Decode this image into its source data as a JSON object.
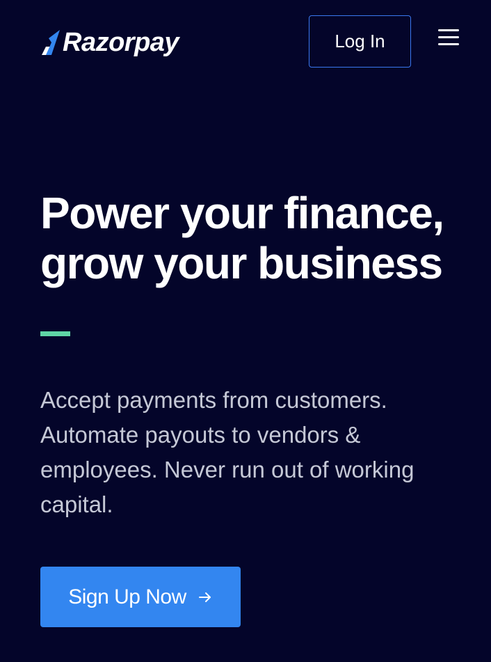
{
  "header": {
    "logo_text": "Razorpay",
    "login_label": "Log In",
    "menu_icon": "hamburger-menu-icon"
  },
  "hero": {
    "title_line1": "Power your finance,",
    "title_line2": "grow your business",
    "subtitle": "Accept payments from customers. Automate payouts to vendors & employees. Never run out of working capital.",
    "cta_label": "Sign Up Now",
    "cta_icon": "arrow-right-icon"
  },
  "colors": {
    "background": "#04052a",
    "accent_green": "#5fd5a5",
    "brand_blue": "#3386f0",
    "login_border": "#3a78f0",
    "subtitle_text": "#c5c8d6"
  }
}
